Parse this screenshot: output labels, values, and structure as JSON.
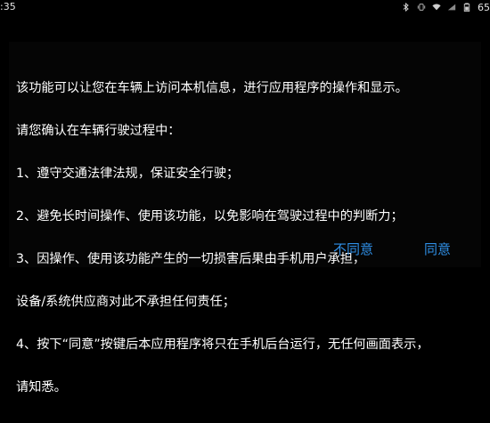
{
  "status_bar": {
    "time": ":35",
    "battery_text": "65"
  },
  "dialog": {
    "lines": [
      "该功能可以让您在车辆上访问本机信息，进行应用程序的操作和显示。",
      "请您确认在车辆行驶过程中：",
      " 1、遵守交通法律法规，保证安全行驶；",
      " 2、避免长时间操作、使用该功能，以免影响在驾驶过程中的判断力；",
      " 3、因操作、使用该功能产生的一切损害后果由手机用户承担，",
      "设备/系统供应商对此不承担任何责任；",
      " 4、按下“同意”按键后本应用程序将只在手机后台运行，无任何画面表示，",
      "请知悉。"
    ],
    "disagree_label": "不同意",
    "agree_label": "同意"
  },
  "colors": {
    "background": "#000000",
    "text": "#ffffff",
    "button_accent": "#2f8fe6"
  },
  "icons": [
    "bluetooth-icon",
    "vibrate-icon",
    "wifi-icon",
    "signal-icon",
    "battery-icon"
  ]
}
